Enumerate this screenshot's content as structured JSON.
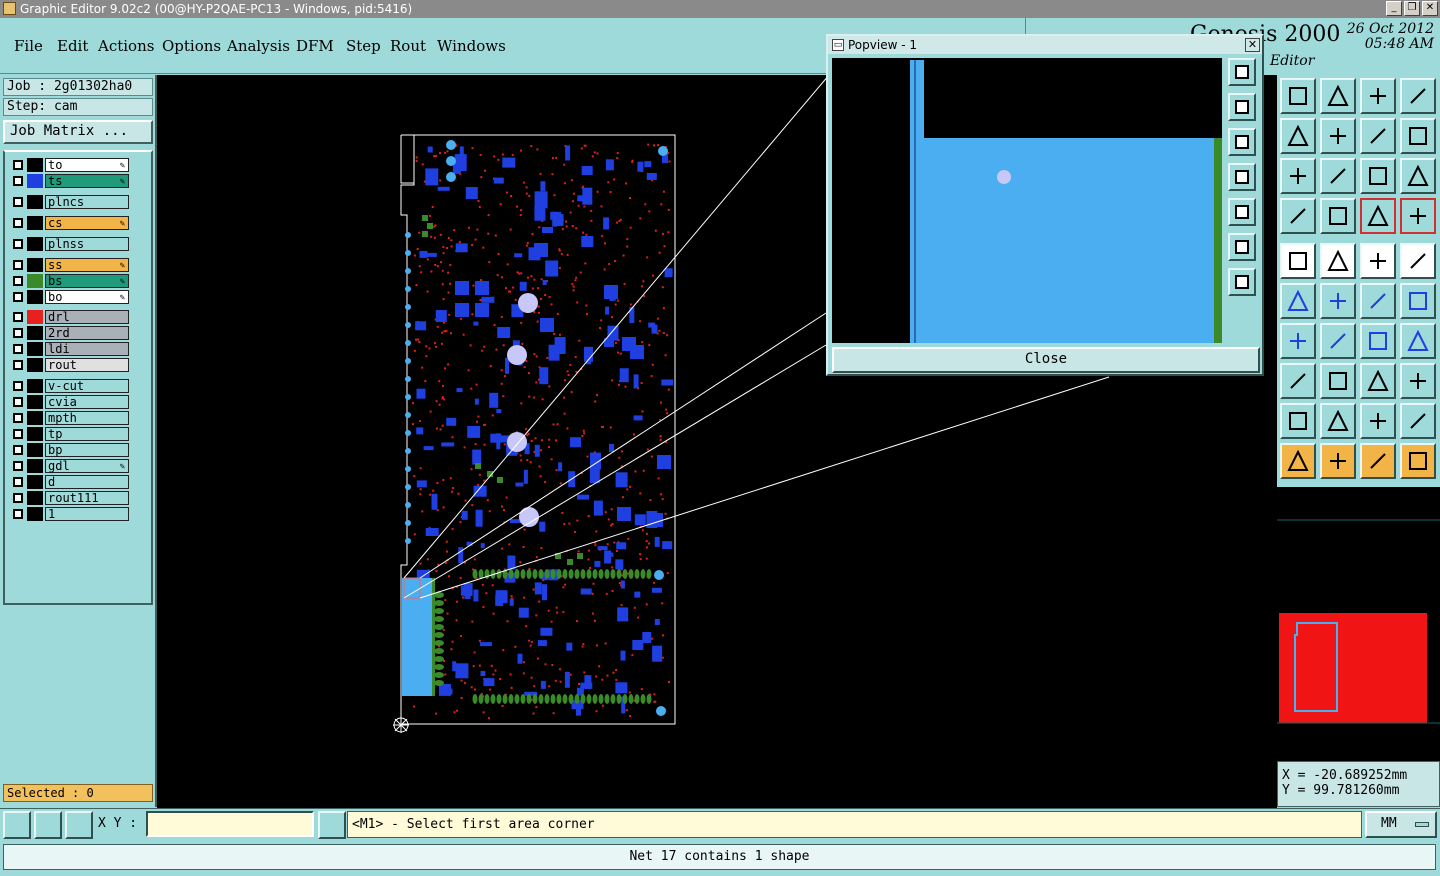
{
  "window": {
    "title": "Graphic Editor 9.02c2 (00@HY-P2QAE-PC13 - Windows, pid:5416)",
    "controls": [
      "_",
      "❐",
      "✕"
    ]
  },
  "menu": [
    "File",
    "Edit",
    "Actions",
    "Options",
    "Analysis",
    "DFM",
    "Step",
    "Rout",
    "Windows"
  ],
  "header": {
    "brand": "Genesis 2000",
    "date": "26 Oct 2012",
    "time": "05:48 AM",
    "subtitle": "Editor"
  },
  "job": {
    "job_label": "Job : 2g01302ha0",
    "step_label": "Step: cam",
    "matrix_button": "Job Matrix ..."
  },
  "layers": [
    {
      "name": "to",
      "swatch": "#000000",
      "bg": "#ffffff",
      "affected": true
    },
    {
      "name": "ts",
      "swatch": "#1f3fe0",
      "bg": "#1f9a7a",
      "affected": true
    },
    {
      "name": "plncs",
      "swatch": "#000000",
      "bg": "#9fdada",
      "affected": false
    },
    {
      "name": "cs",
      "swatch": "#000000",
      "bg": "#f2b447",
      "affected": true
    },
    {
      "name": "plnss",
      "swatch": "#000000",
      "bg": "#9fdada",
      "affected": false
    },
    {
      "name": "ss",
      "swatch": "#000000",
      "bg": "#f2b447",
      "affected": true
    },
    {
      "name": "bs",
      "swatch": "#3a8a2a",
      "bg": "#1f9a7a",
      "affected": true
    },
    {
      "name": "bo",
      "swatch": "#000000",
      "bg": "#ffffff",
      "affected": true
    },
    {
      "name": "drl",
      "swatch": "#e82020",
      "bg": "#aab0b8",
      "affected": false
    },
    {
      "name": "2rd",
      "swatch": "#000000",
      "bg": "#aab0b8",
      "affected": false
    },
    {
      "name": "ldi",
      "swatch": "#000000",
      "bg": "#aab0b8",
      "affected": false
    },
    {
      "name": "rout",
      "swatch": "#000000",
      "bg": "#e0e0e0",
      "affected": false
    },
    {
      "name": "v-cut",
      "swatch": "#000000",
      "bg": "#9fdada",
      "affected": false
    },
    {
      "name": "cvia",
      "swatch": "#000000",
      "bg": "#9fdada",
      "affected": false
    },
    {
      "name": "mpth",
      "swatch": "#000000",
      "bg": "#9fdada",
      "affected": false
    },
    {
      "name": "tp",
      "swatch": "#000000",
      "bg": "#9fdada",
      "affected": false
    },
    {
      "name": "bp",
      "swatch": "#000000",
      "bg": "#9fdada",
      "affected": false
    },
    {
      "name": "gdl",
      "swatch": "#000000",
      "bg": "#9fdada",
      "affected": true
    },
    {
      "name": "d",
      "swatch": "#000000",
      "bg": "#9fdada",
      "affected": false
    },
    {
      "name": "rout111",
      "swatch": "#000000",
      "bg": "#9fdada",
      "affected": false
    },
    {
      "name": "1",
      "swatch": "#000000",
      "bg": "#9fdada",
      "affected": false
    }
  ],
  "selected": "Selected : 0",
  "popview": {
    "title": "Popview - 1",
    "close_button": "Close"
  },
  "coords": {
    "x": "X = -20.689252mm",
    "y": "Y = 99.781260mm"
  },
  "command": {
    "xy_label": "X Y :",
    "xy_value": "",
    "prompt": "<M1> - Select first area corner",
    "units": "MM"
  },
  "status": "Net 17 contains 1 shape",
  "colors": {
    "panel": "#9fdada",
    "pad_blue": "#1f3fe0",
    "light_blue": "#4aaef0",
    "green_pad": "#3a8a2a",
    "drill_red": "#e02020",
    "overview_red": "#f01414"
  }
}
